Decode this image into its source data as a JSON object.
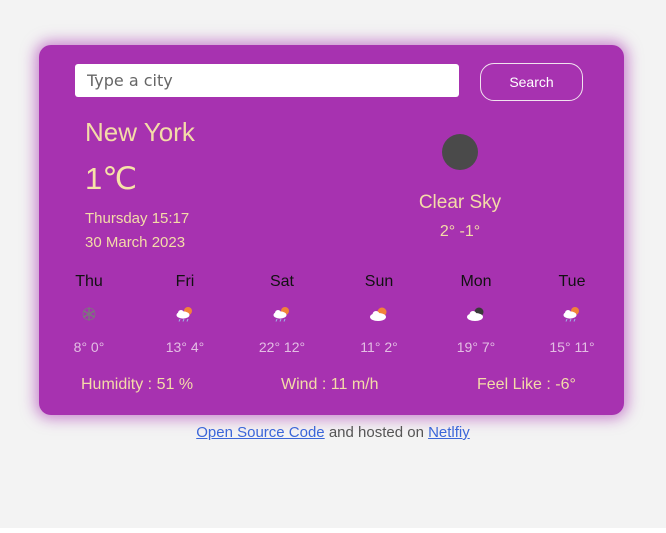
{
  "search": {
    "placeholder": "Type a city",
    "button_label": "Search"
  },
  "current": {
    "city": "New York",
    "temperature": "1℃",
    "day_time": "Thursday 15:17",
    "date": "30 March 2023",
    "icon": "moon-icon",
    "condition": "Clear Sky",
    "range": "2° -1°"
  },
  "forecast": [
    {
      "day": "Thu",
      "icon": "snowflake-icon",
      "temps": "8° 0°"
    },
    {
      "day": "Fri",
      "icon": "sun-rain-cloud-icon",
      "temps": "13° 4°"
    },
    {
      "day": "Sat",
      "icon": "sun-rain-cloud-icon",
      "temps": "22° 12°"
    },
    {
      "day": "Sun",
      "icon": "sun-cloud-icon",
      "temps": "11° 2°"
    },
    {
      "day": "Mon",
      "icon": "night-cloud-icon",
      "temps": "19° 7°"
    },
    {
      "day": "Tue",
      "icon": "sun-rain-cloud-icon",
      "temps": "15° 11°"
    }
  ],
  "stats": {
    "humidity": "Humidity : 51 %",
    "wind": "Wind : 11 m/h",
    "feels_like": "Feel Like : -6°"
  },
  "footer": {
    "source_link": "Open Source Code",
    "middle_text": " and hosted on ",
    "host_link": "Netlfiy"
  },
  "colors": {
    "card": "#a732b0",
    "accent_text": "#f4dca8",
    "page_background": "#f3f3f3",
    "link": "#3b66d9"
  }
}
